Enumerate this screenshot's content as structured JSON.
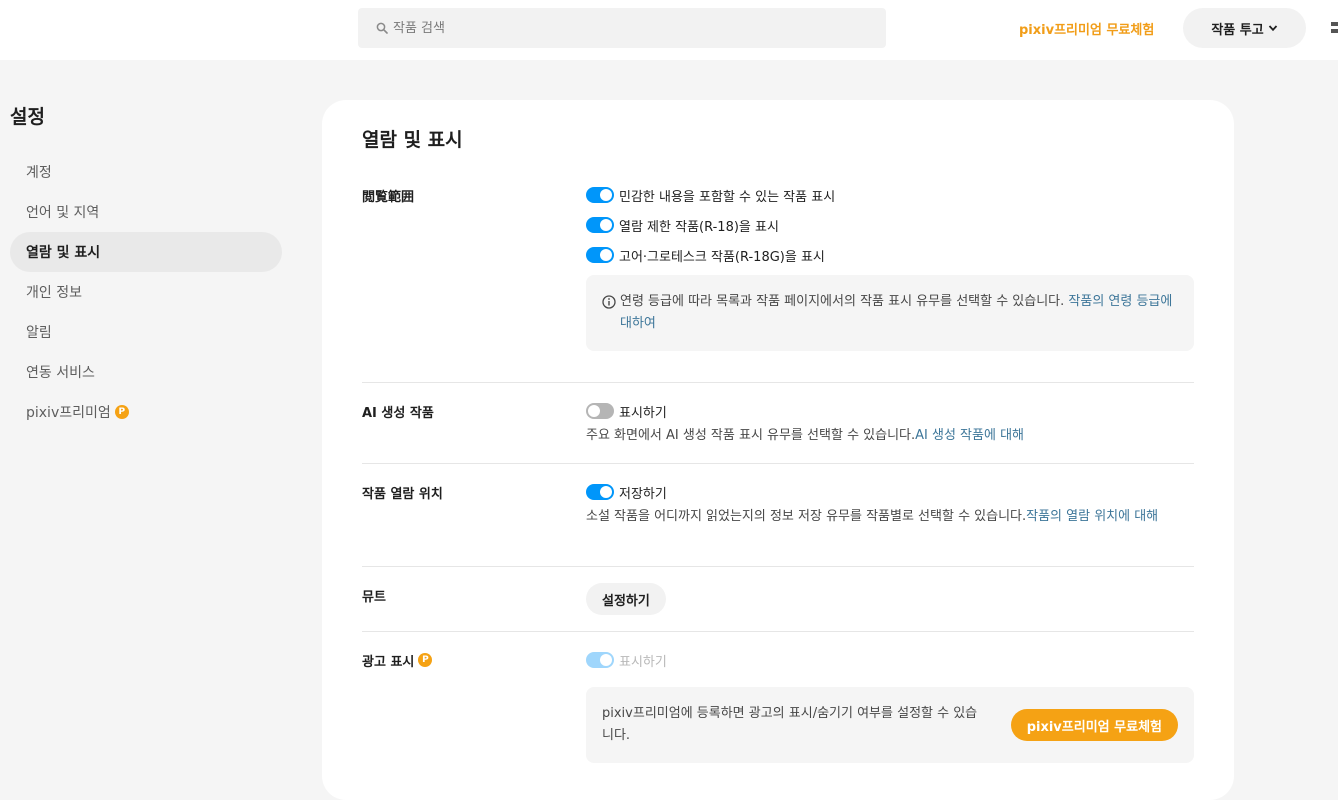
{
  "header": {
    "search_placeholder": "작품 검색",
    "premium_link": "pixiv프리미엄 무료체험",
    "post_button": "작품 투고"
  },
  "sidebar": {
    "title": "설정",
    "items": [
      {
        "label": "계정"
      },
      {
        "label": "언어 및 지역"
      },
      {
        "label": "열람 및 표시"
      },
      {
        "label": "개인 정보"
      },
      {
        "label": "알림"
      },
      {
        "label": "연동 서비스"
      },
      {
        "label": "pixiv프리미엄"
      }
    ]
  },
  "main": {
    "title": "열람 및 표시",
    "viewing_range": {
      "label": "閲覧範囲",
      "toggles": [
        {
          "label": "민감한 내용을 포함할 수 있는 작품 표시",
          "on": true
        },
        {
          "label": "열람 제한 작품(R-18)을 표시",
          "on": true
        },
        {
          "label": "고어·그로테스크 작품(R-18G)을 표시",
          "on": true
        }
      ],
      "info_text": "연령 등급에 따라 목록과 작품 페이지에서의 작품 표시 유무를 선택할 수 있습니다. ",
      "info_link": "작품의 연령 등급에 대하여"
    },
    "ai": {
      "label": "AI 생성 작품",
      "toggle_label": "표시하기",
      "on": false,
      "desc": "주요 화면에서 AI 생성 작품 표시 유무를 선택할 수 있습니다.",
      "link": "AI 생성 작품에 대해"
    },
    "position": {
      "label": "작품 열람 위치",
      "toggle_label": "저장하기",
      "on": true,
      "desc": "소설 작품을 어디까지 읽었는지의 정보 저장 유무를 작품별로 선택할 수 있습니다.",
      "link": "작품의 열람 위치에 대해"
    },
    "mute": {
      "label": "뮤트",
      "button": "설정하기"
    },
    "ads": {
      "label": "광고 표시",
      "toggle_label": "표시하기",
      "on": true,
      "desc": "pixiv프리미엄에 등록하면 광고의 표시/숨기기 여부를 설정할 수 있습니다.",
      "button": "pixiv프리미엄 무료체험"
    }
  },
  "colors": {
    "accent_blue": "#0096fa",
    "premium_orange": "#f5a214",
    "link_blue": "#3d7699"
  }
}
